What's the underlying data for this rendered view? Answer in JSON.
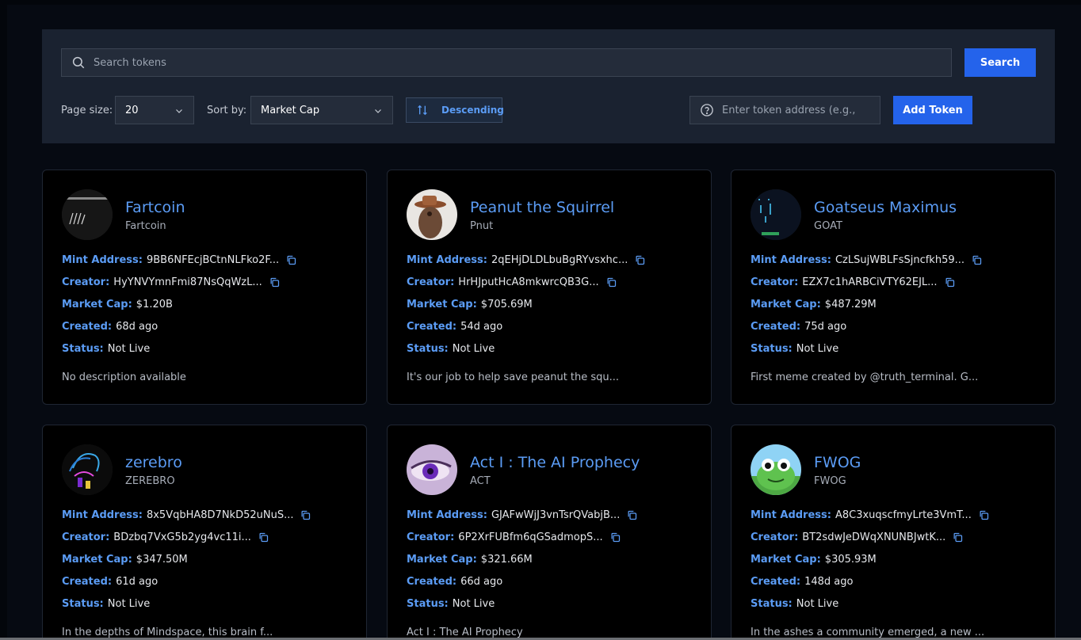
{
  "search": {
    "placeholder": "Search tokens",
    "button_label": "Search"
  },
  "filters": {
    "page_size_label": "Page size:",
    "page_size_value": "20",
    "sort_label": "Sort by:",
    "sort_value": "Market Cap",
    "order_label": "Descending",
    "address_placeholder": "Enter token address (e.g.,",
    "add_button_label": "Add Token"
  },
  "labels": {
    "mint": "Mint Address:",
    "creator": "Creator:",
    "market_cap": "Market Cap:",
    "created": "Created:",
    "status": "Status:"
  },
  "colors": {
    "accent": "#5b9cf5",
    "primary_button": "#2463eb",
    "card_bg": "#000000",
    "panel_bg": "#1a2230"
  },
  "tokens": [
    {
      "name": "Fartcoin",
      "symbol": "Fartcoin",
      "mint": "9BB6NFEcjBCtnNLFko2F...",
      "creator": "HyYNVYmnFmi87NsQqWzL...",
      "market_cap": "$1.20B",
      "created": "68d ago",
      "status": "Not Live",
      "description": "No description available",
      "avatar": "fartcoin-avatar"
    },
    {
      "name": "Peanut the Squirrel",
      "symbol": "Pnut",
      "mint": "2qEHjDLDLbuBgRYvsxhc...",
      "creator": "HrHJputHcA8mkwrcQB3G...",
      "market_cap": "$705.69M",
      "created": "54d ago",
      "status": "Not Live",
      "description": "It's our job to help save peanut the squ...",
      "avatar": "squirrel-avatar"
    },
    {
      "name": "Goatseus Maximus",
      "symbol": "GOAT",
      "mint": "CzLSujWBLFsSjncfkh59...",
      "creator": "EZX7c1hARBCiVTY62EJL...",
      "market_cap": "$487.29M",
      "created": "75d ago",
      "status": "Not Live",
      "description": "First meme created by @truth_terminal. G...",
      "avatar": "goat-avatar"
    },
    {
      "name": "zerebro",
      "symbol": "ZEREBRO",
      "mint": "8x5VqbHA8D7NkD52uNuS...",
      "creator": "BDzbq7VxG5b2yg4vc11i...",
      "market_cap": "$347.50M",
      "created": "61d ago",
      "status": "Not Live",
      "description": "In the depths of Mindspace, this brain f...",
      "avatar": "zerebro-avatar"
    },
    {
      "name": "Act I : The AI Prophecy",
      "symbol": "ACT",
      "mint": "GJAFwWjJ3vnTsrQVabjB...",
      "creator": "6P2XrFUBfm6qGSadmopS...",
      "market_cap": "$321.66M",
      "created": "66d ago",
      "status": "Not Live",
      "description": "Act I : The AI Prophecy",
      "avatar": "act-avatar"
    },
    {
      "name": "FWOG",
      "symbol": "FWOG",
      "mint": "A8C3xuqscfmyLrte3VmT...",
      "creator": "BT2sdwJeDWqXNUNBJwtK...",
      "market_cap": "$305.93M",
      "created": "148d ago",
      "status": "Not Live",
      "description": "In the ashes a community emerged, a new ...",
      "avatar": "frog-avatar"
    }
  ]
}
